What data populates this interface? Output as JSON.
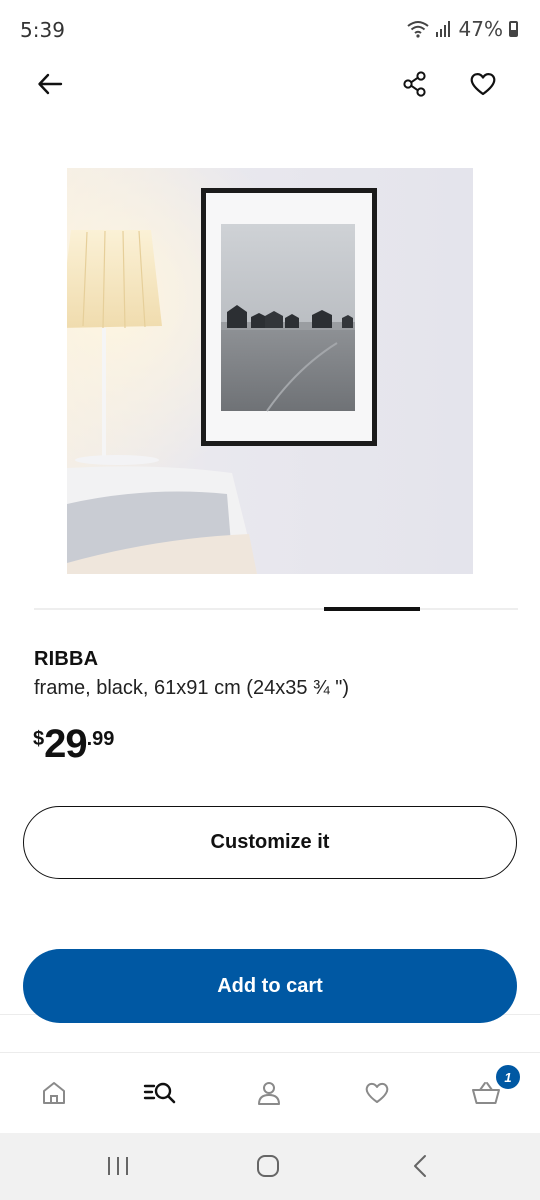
{
  "status_bar": {
    "time": "5:39",
    "battery": "47%"
  },
  "icons": {
    "back": "arrow-left-icon",
    "share": "share-icon",
    "favorite": "heart-icon",
    "nav_home": "home-icon",
    "nav_search": "search-list-icon",
    "nav_profile": "profile-icon",
    "nav_favorites": "heart-icon",
    "nav_cart": "cart-icon",
    "sys_recents": "recents-icon",
    "sys_home": "home-circle-icon",
    "sys_back": "chevron-left-icon"
  },
  "product": {
    "name": "RIBBA",
    "description": "frame, black, 61x91 cm (24x35 ¾ \")",
    "price": {
      "currency": "$",
      "integer": "29",
      "decimal": ".99"
    }
  },
  "carousel": {
    "active_index": 3,
    "total": 4
  },
  "actions": {
    "customize_label": "Customize it",
    "add_to_cart_label": "Add to cart"
  },
  "cart": {
    "badge_count": "1"
  },
  "colors": {
    "accent": "#0058a3",
    "text": "#111111"
  }
}
